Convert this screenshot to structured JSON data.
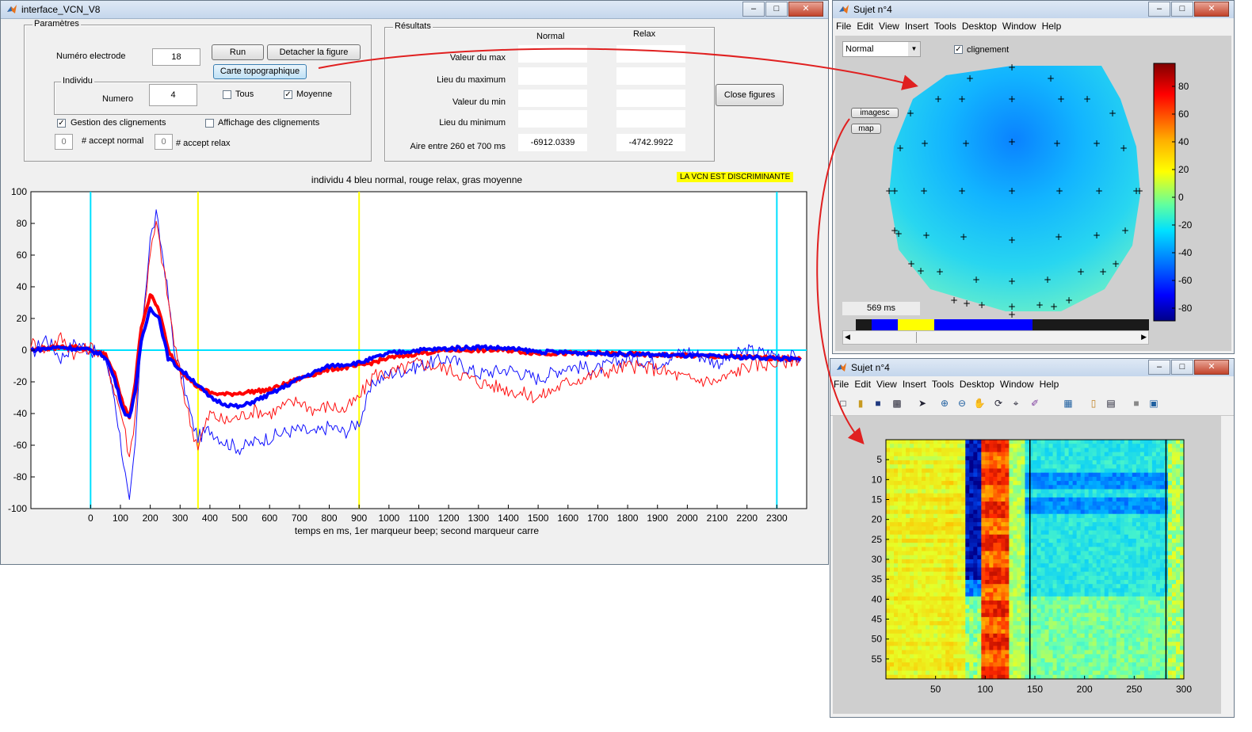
{
  "main_window": {
    "title": "interface_VCN_V8",
    "parametres": {
      "title": "Paramètres",
      "electrode_label": "Numéro electrode",
      "electrode_value": "18",
      "run_button": "Run",
      "detach_button": "Detacher la figure",
      "carte_button": "Carte topographique",
      "individu_title": "Individu",
      "numero_label": "Numero",
      "numero_value": "4",
      "tous_label": "Tous",
      "moyenne_label": "Moyenne",
      "gestion_label": "Gestion des clignements",
      "affichage_label": "Affichage des clignements",
      "accept_normal_value": "0",
      "accept_normal_label": "# accept normal",
      "accept_relax_value": "0",
      "accept_relax_label": "# accept relax"
    },
    "resultats": {
      "title": "Résultats",
      "col_normal": "Normal",
      "col_relax": "Relax",
      "rows": [
        {
          "label": "Valeur du max",
          "normal": "",
          "relax": ""
        },
        {
          "label": "Lieu du maximum",
          "normal": "",
          "relax": ""
        },
        {
          "label": "Valeur du min",
          "normal": "",
          "relax": ""
        },
        {
          "label": "Lieu du minimum",
          "normal": "",
          "relax": ""
        },
        {
          "label": "Aire entre 260 et 700 ms",
          "normal": "-6912.0339",
          "relax": "-4742.9922"
        }
      ]
    },
    "close_button": "Close figures",
    "badge": "LA VCN EST DISCRIMINANTE"
  },
  "chart_data": [
    {
      "type": "line",
      "title": "individu 4 bleu normal, rouge relax, gras moyenne",
      "xlabel": "temps en ms, 1er marqueur beep; second marqueur carre",
      "ylabel": "",
      "xlim": [
        -200,
        2400
      ],
      "ylim": [
        -100,
        100
      ],
      "yticks": [
        "100",
        "80",
        "60",
        "40",
        "20",
        "0",
        "-20",
        "-40",
        "-60",
        "-80",
        "-100"
      ],
      "xticks": [
        "0",
        "100",
        "200",
        "300",
        "400",
        "500",
        "600",
        "700",
        "800",
        "900",
        "1000",
        "1100",
        "1200",
        "1300",
        "1400",
        "1500",
        "1600",
        "1700",
        "1800",
        "1900",
        "2000",
        "2100",
        "2200",
        "2300"
      ],
      "markers": [
        {
          "x": 0,
          "color": "#00e0ff"
        },
        {
          "x": 360,
          "color": "#ffff00"
        },
        {
          "x": 900,
          "color": "#ffff00"
        },
        {
          "x": 2300,
          "color": "#00e0ff"
        }
      ],
      "series": [
        {
          "color": "#1010ff",
          "style": "thin",
          "x": [
            -200,
            -150,
            -100,
            -50,
            0,
            50,
            80,
            110,
            130,
            150,
            170,
            200,
            220,
            250,
            280,
            310,
            340,
            360,
            400,
            450,
            500,
            550,
            600,
            650,
            700,
            750,
            800,
            850,
            900,
            950,
            1000,
            1100,
            1200,
            1300,
            1400,
            1500,
            1600,
            1700,
            1800,
            1900,
            2000,
            2100,
            2200,
            2300,
            2380
          ],
          "y": [
            -3,
            8,
            -5,
            5,
            0,
            -5,
            -30,
            -70,
            -98,
            -60,
            10,
            70,
            85,
            50,
            0,
            -20,
            -45,
            -55,
            -50,
            -58,
            -62,
            -58,
            -55,
            -52,
            -50,
            -53,
            -48,
            -52,
            -45,
            -20,
            -15,
            -10,
            -5,
            -15,
            -12,
            -18,
            -10,
            -12,
            -5,
            -8,
            0,
            -8,
            0,
            -3,
            -5
          ]
        },
        {
          "color": "#ff1010",
          "style": "thin",
          "x": [
            -200,
            -150,
            -100,
            -50,
            0,
            50,
            80,
            110,
            130,
            150,
            170,
            200,
            220,
            250,
            280,
            310,
            340,
            360,
            400,
            450,
            500,
            550,
            600,
            650,
            700,
            750,
            800,
            850,
            900,
            950,
            1000,
            1100,
            1200,
            1300,
            1400,
            1500,
            1600,
            1700,
            1800,
            1900,
            2000,
            2100,
            2200,
            2300,
            2380
          ],
          "y": [
            5,
            0,
            8,
            -3,
            2,
            -5,
            -25,
            -45,
            -68,
            -40,
            10,
            60,
            80,
            45,
            5,
            -25,
            -50,
            -60,
            -40,
            -45,
            -42,
            -38,
            -40,
            -35,
            -32,
            -38,
            -35,
            -38,
            -30,
            -15,
            -15,
            -8,
            -12,
            -20,
            -25,
            -30,
            -20,
            -15,
            -10,
            -12,
            -18,
            -20,
            -10,
            -8,
            -5
          ]
        },
        {
          "color": "#ff0000",
          "style": "thick",
          "x": [
            -200,
            -150,
            -100,
            -50,
            0,
            50,
            80,
            110,
            130,
            150,
            170,
            200,
            230,
            260,
            300,
            350,
            400,
            450,
            500,
            600,
            700,
            800,
            900,
            1000,
            1100,
            1200,
            1300,
            1400,
            1500,
            1700,
            1900,
            2100,
            2300,
            2380
          ],
          "y": [
            0,
            1,
            2,
            2,
            0,
            -3,
            -15,
            -35,
            -42,
            -20,
            15,
            35,
            25,
            0,
            -12,
            -22,
            -27,
            -28,
            -27,
            -25,
            -18,
            -12,
            -10,
            -5,
            -2,
            0,
            0,
            0,
            -2,
            -2,
            -3,
            -4,
            -5,
            -6
          ]
        },
        {
          "color": "#0000ff",
          "style": "thick",
          "x": [
            -200,
            -150,
            -100,
            -50,
            0,
            50,
            80,
            110,
            130,
            150,
            170,
            200,
            230,
            260,
            300,
            350,
            400,
            450,
            500,
            600,
            700,
            800,
            900,
            1000,
            1100,
            1200,
            1300,
            1400,
            1500,
            1700,
            1900,
            2100,
            2300,
            2380
          ],
          "y": [
            0,
            1,
            2,
            1,
            0,
            -4,
            -18,
            -38,
            -43,
            -25,
            5,
            27,
            20,
            -5,
            -12,
            -20,
            -30,
            -34,
            -36,
            -28,
            -18,
            -10,
            -8,
            -2,
            0,
            1,
            2,
            1,
            -1,
            -2,
            -3,
            -4,
            -5,
            -6
          ]
        }
      ]
    },
    {
      "type": "heatmap",
      "title": "",
      "xlim": [
        0,
        300
      ],
      "ylim": [
        0,
        60
      ],
      "xticks": [
        "50",
        "100",
        "150",
        "200",
        "250",
        "300"
      ],
      "yticks": [
        "5",
        "10",
        "15",
        "20",
        "25",
        "30",
        "35",
        "40",
        "45",
        "50",
        "55"
      ],
      "vlines": [
        145,
        282
      ]
    }
  ],
  "topo_window": {
    "title": "Sujet n°4",
    "menu": [
      "File",
      "Edit",
      "View",
      "Insert",
      "Tools",
      "Desktop",
      "Window",
      "Help"
    ],
    "dropdown_value": "Normal",
    "clignement_label": "clignement",
    "imagesc_button": "imagesc",
    "map_button": "map",
    "time_readout": "569 ms",
    "colorbar_ticks": [
      "80",
      "60",
      "40",
      "20",
      "0",
      "-20",
      "-40",
      "-60",
      "-80"
    ]
  },
  "heatmap_window": {
    "title": "Sujet n°4",
    "menu": [
      "File",
      "Edit",
      "View",
      "Insert",
      "Tools",
      "Desktop",
      "Window",
      "Help"
    ]
  }
}
